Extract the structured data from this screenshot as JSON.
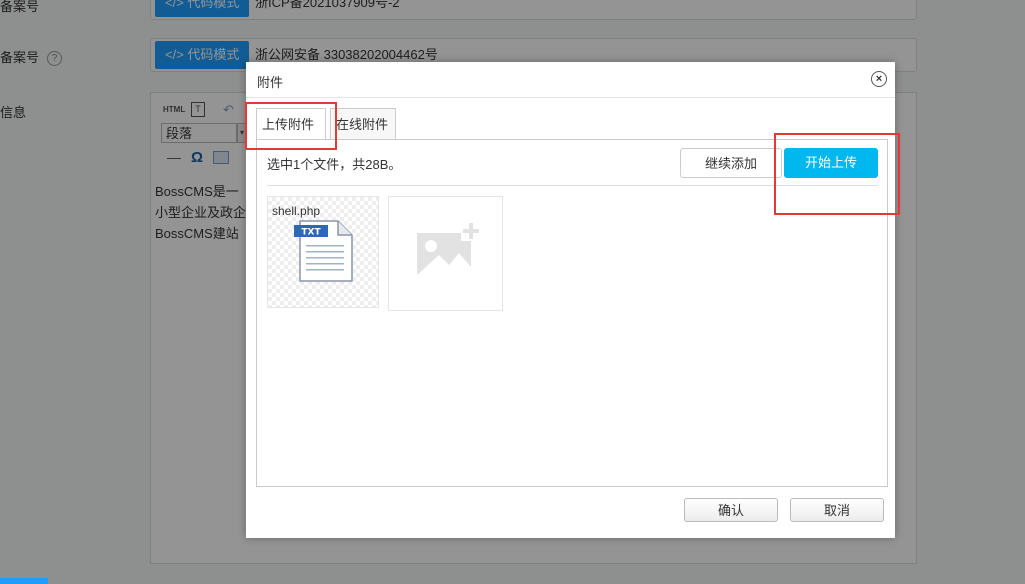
{
  "background_form": {
    "row1": {
      "label": "备案号",
      "code_button": "</> 代码模式",
      "value": "浙ICP备2021037909号-2"
    },
    "row2": {
      "label": "备案号",
      "help": "?",
      "code_button": "</> 代码模式",
      "value": "浙公网安备 33038202004462号"
    },
    "row3": {
      "label": "信息"
    },
    "editor": {
      "html_label": "HTML",
      "paragraph_select": "段落",
      "omega": "Ω",
      "text_lines": [
        "BossCMS是一",
        "小型企业及政企",
        "BossCMS建站"
      ]
    }
  },
  "dialog": {
    "title": "附件",
    "close_icon": "×",
    "tabs": [
      {
        "label": "上传附件",
        "active": true
      },
      {
        "label": "在线附件",
        "active": false
      }
    ],
    "status_text": "选中1个文件，共28B。",
    "continue_add_label": "继续添加",
    "start_upload_label": "开始上传",
    "files": [
      {
        "name": "shell.php",
        "type_badge": "TXT"
      }
    ],
    "confirm_label": "确认",
    "cancel_label": "取消"
  },
  "colors": {
    "primary_blue": "#00b7ee",
    "highlight_red": "#e53935",
    "overlay": "rgba(0,0,0,0.42)"
  }
}
